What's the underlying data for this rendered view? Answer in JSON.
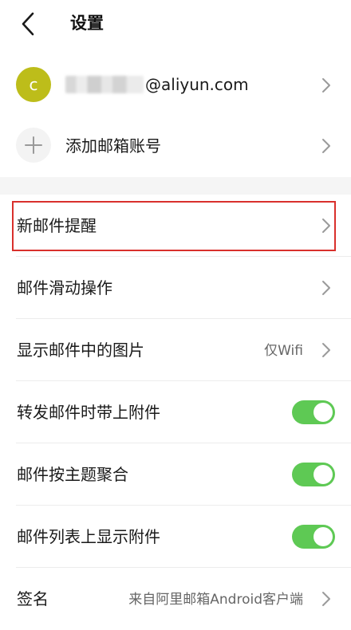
{
  "header": {
    "title": "设置"
  },
  "account": {
    "avatar_letter": "c",
    "email_domain": "@aliyun.com"
  },
  "add_account": {
    "label": "添加邮箱账号"
  },
  "settings": {
    "new_mail_alert": "新邮件提醒",
    "swipe_actions": "邮件滑动操作",
    "show_images": {
      "label": "显示邮件中的图片",
      "value": "仅Wifi"
    },
    "forward_attachments": {
      "label": "转发邮件时带上附件",
      "enabled": true
    },
    "group_by_subject": {
      "label": "邮件按主题聚合",
      "enabled": true
    },
    "show_attachments_in_list": {
      "label": "邮件列表上显示附件",
      "enabled": true
    },
    "signature": {
      "label": "签名",
      "value": "来自阿里邮箱Android客户端"
    }
  },
  "colors": {
    "avatar": "#bdbd1a",
    "toggle_on": "#5ec954",
    "highlight": "#d9302c"
  },
  "icons": [
    "back-arrow-icon",
    "plus-icon",
    "chevron-right-icon"
  ]
}
